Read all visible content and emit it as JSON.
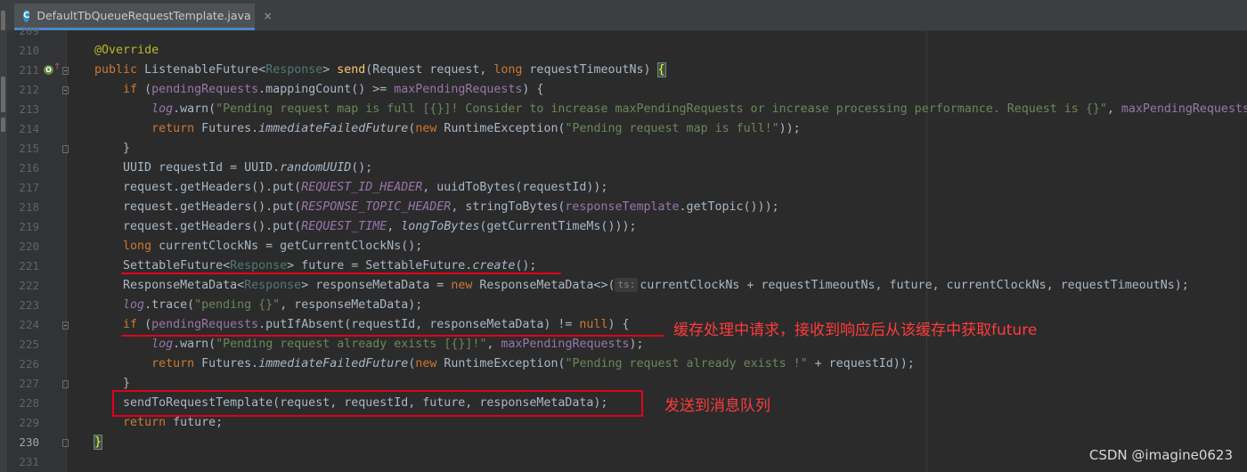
{
  "tab": {
    "file_name": "DefaultTbQueueRequestTemplate.java",
    "icon_letter": "C",
    "close": "×"
  },
  "gutter": {
    "line_numbers": [
      "209",
      "210",
      "211",
      "212",
      "213",
      "214",
      "215",
      "216",
      "217",
      "218",
      "219",
      "220",
      "221",
      "222",
      "223",
      "224",
      "225",
      "226",
      "227",
      "228",
      "229",
      "230",
      "231"
    ],
    "current_line": "230"
  },
  "annotations": {
    "cache_note": "缓存处理中请求，接收到响应后从该缓存中获取future",
    "send_note": "发送到消息队列"
  },
  "watermark": "CSDN @imagine0623",
  "colors": {
    "annotation_red": "#e3001b",
    "keyword": "#cc7832",
    "string": "#6a8759",
    "method": "#ffc66d",
    "field": "#9876aa"
  }
}
